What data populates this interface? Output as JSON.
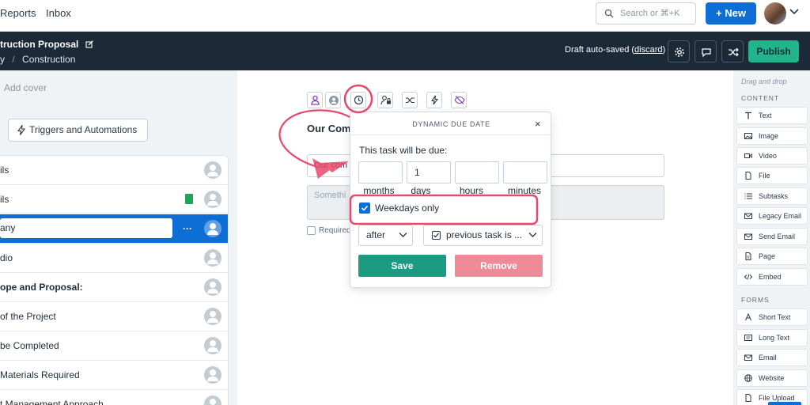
{
  "nav": {
    "reports": "Reports",
    "inbox": "Inbox",
    "search_placeholder": "Search or ⌘+K",
    "new_button": "+ New"
  },
  "header": {
    "title": "truction Proposal",
    "crumb_prefix": "y",
    "crumb_sep": "/",
    "crumb": "Construction",
    "draft_text": "Draft auto-saved (",
    "discard": "discard",
    "draft_close": ")",
    "publish": "Publish"
  },
  "left": {
    "add_cover": "Add cover",
    "triggers": "Triggers and Automations",
    "tasks": [
      {
        "label": "ils"
      },
      {
        "label": "ils"
      },
      {
        "label": "any"
      },
      {
        "label": "dio"
      },
      {
        "label": "ope and Proposal:"
      },
      {
        "label": "of the Project"
      },
      {
        "label": "be Completed"
      },
      {
        "label": "Materials Required"
      },
      {
        "label": "t Management Approach"
      }
    ],
    "active_dots": "···"
  },
  "middle": {
    "title": "Our Com",
    "field_value": "Our com",
    "field_placeholder": "Somethi",
    "required": "Required"
  },
  "popover": {
    "title": "DYNAMIC DUE DATE",
    "close": "×",
    "prompt": "This task will be due:",
    "fields": [
      {
        "value": "",
        "unit": "months"
      },
      {
        "value": "1",
        "unit": "days"
      },
      {
        "value": "",
        "unit": "hours"
      },
      {
        "value": "",
        "unit": "minutes"
      }
    ],
    "weekdays_label": "Weekdays only",
    "weekdays_checked": true,
    "relation": "after",
    "reference": "previous task is ...",
    "save": "Save",
    "remove": "Remove"
  },
  "right": {
    "drag_drop": "Drag and drop",
    "content_heading": "CONTENT",
    "content_items": [
      "Text",
      "Image",
      "Video",
      "File",
      "Subtasks",
      "Legacy Email",
      "Send Email",
      "Page",
      "Embed"
    ],
    "forms_heading": "FORMS",
    "form_items": [
      "Short Text",
      "Long Text",
      "Email",
      "Website",
      "File Upload"
    ]
  },
  "colors": {
    "primary": "#0d6fd6",
    "publish": "#20b58b",
    "save": "#1a9b82",
    "remove": "#ef8a98",
    "dark": "#1c2a37",
    "annotation": "#e8486a"
  }
}
